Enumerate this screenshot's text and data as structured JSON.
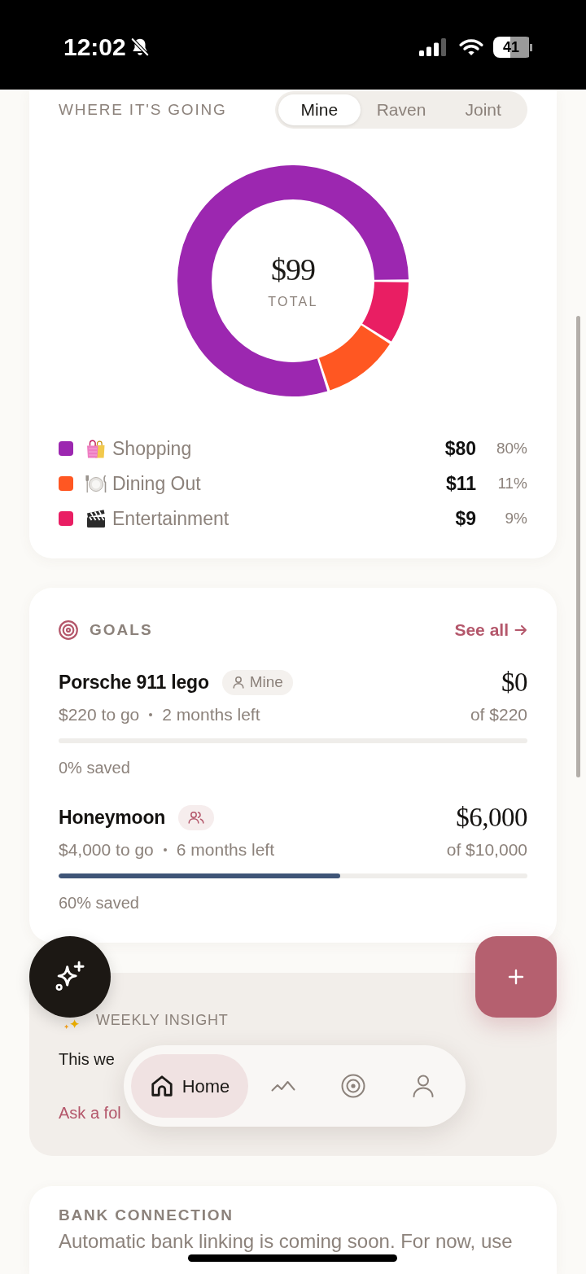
{
  "status_bar": {
    "time": "12:02",
    "battery": "41"
  },
  "spending": {
    "title": "WHERE IT'S GOING",
    "tabs": [
      {
        "label": "Mine",
        "selected": true
      },
      {
        "label": "Raven",
        "selected": false
      },
      {
        "label": "Joint",
        "selected": false
      }
    ],
    "total": "$99",
    "total_label": "TOTAL",
    "chart_data": {
      "type": "donut",
      "categories": [
        "Shopping",
        "Dining Out",
        "Entertainment"
      ],
      "values": [
        80,
        11,
        9
      ]
    },
    "legend": [
      {
        "color": "#9c27b0",
        "amount": "$80",
        "percent": "80%"
      },
      {
        "color": "#ff5722",
        "amount": "$11",
        "percent": "11%"
      },
      {
        "color": "#e91e63",
        "amount": "$9",
        "percent": "9%"
      }
    ]
  },
  "goals": {
    "title": "GOALS",
    "link": "See all",
    "items": [
      {
        "name": "Porsche 911 lego",
        "owner": {
          "kind": "single",
          "label": "Mine"
        },
        "saved": "$0",
        "target": "of $220",
        "remaining": "$220 to go",
        "time_left": "2 months left",
        "progress": "0% saved"
      },
      {
        "name": "Honeymoon",
        "owner": {
          "kind": "group"
        },
        "saved": "$6,000",
        "target": "of $10,000",
        "remaining": "$4,000 to go",
        "time_left": "6 months left",
        "level": 0.6,
        "progress": "60% saved"
      }
    ]
  },
  "insight": {
    "title": "WEEKLY INSIGHT",
    "text": "This we",
    "link": "Ask a fol"
  },
  "bank": {
    "title": "BANK CONNECTION",
    "text": "Automatic bank linking is coming soon. For now, use"
  },
  "nav": {
    "items": [
      {
        "label": "Home",
        "selected": true
      },
      {
        "selected": false
      },
      {
        "selected": false
      },
      {
        "selected": false
      }
    ]
  }
}
